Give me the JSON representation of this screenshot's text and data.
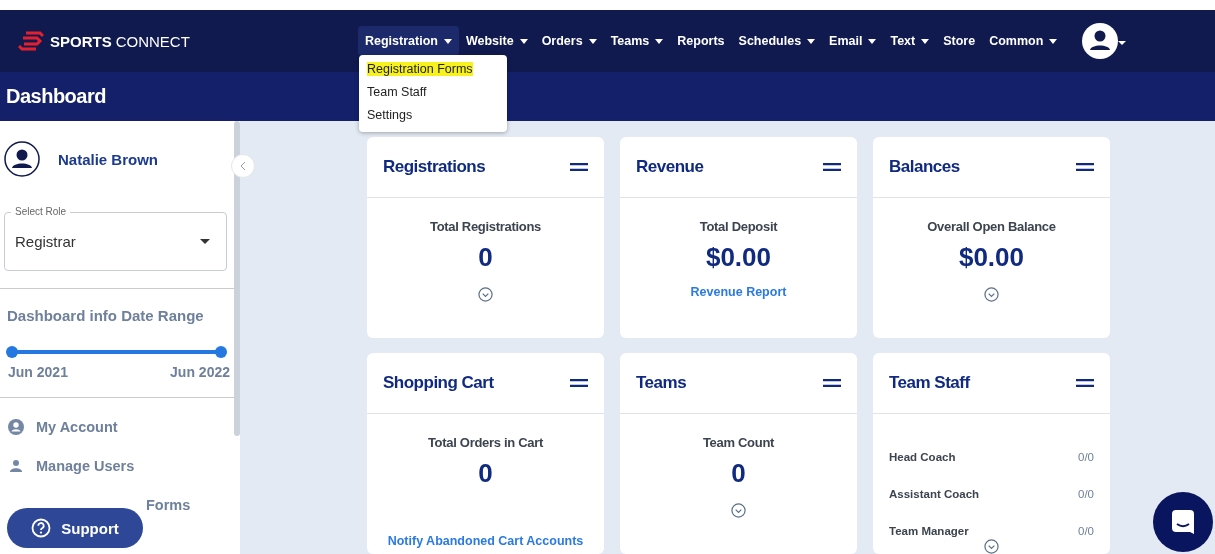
{
  "header": {
    "logo": {
      "bold": "SPORTS",
      "light": "CONNECT"
    },
    "menu": [
      {
        "label": "Registration",
        "caret": true,
        "selected": true
      },
      {
        "label": "Website",
        "caret": true,
        "selected": false
      },
      {
        "label": "Orders",
        "caret": true,
        "selected": false
      },
      {
        "label": "Teams",
        "caret": true,
        "selected": false
      },
      {
        "label": "Reports",
        "caret": false,
        "selected": false
      },
      {
        "label": "Schedules",
        "caret": true,
        "selected": false
      },
      {
        "label": "Email",
        "caret": true,
        "selected": false
      },
      {
        "label": "Text",
        "caret": true,
        "selected": false
      },
      {
        "label": "Store",
        "caret": false,
        "selected": false
      },
      {
        "label": "Common",
        "caret": true,
        "selected": false
      }
    ],
    "dropdown": [
      {
        "label": "Registration Forms",
        "highlighted": true
      },
      {
        "label": "Team Staff",
        "highlighted": false
      },
      {
        "label": "Settings",
        "highlighted": false
      }
    ]
  },
  "page_title": "Dashboard",
  "sidebar": {
    "user": "Natalie Brown",
    "role_field": {
      "label": "Select Role",
      "value": "Registrar"
    },
    "date_range": {
      "title": "Dashboard info Date Range",
      "thumbs": [
        {
          "level": 0
        },
        {
          "level": 1
        }
      ],
      "start": "Jun 2021",
      "end": "Jun 2022"
    },
    "items": [
      {
        "label": "My Account",
        "kind": "account"
      },
      {
        "label": "Manage Users",
        "kind": "user"
      },
      {
        "label": "Forms",
        "kind": "covered"
      }
    ],
    "support": "Support"
  },
  "cards": [
    {
      "title": "Registrations",
      "kind": "metric",
      "label": "Total Registrations",
      "value": "0",
      "expand": true
    },
    {
      "title": "Revenue",
      "kind": "metric",
      "label": "Total Deposit",
      "value": "$0.00",
      "link": "Revenue Report",
      "expand": false
    },
    {
      "title": "Balances",
      "kind": "metric",
      "label": "Overall Open Balance",
      "value": "$0.00",
      "expand": true
    },
    {
      "title": "Shopping Cart",
      "kind": "metric",
      "label": "Total Orders in Cart",
      "value": "0",
      "link": "Notify Abandoned Cart Accounts",
      "expand": false
    },
    {
      "title": "Teams",
      "kind": "metric",
      "label": "Team Count",
      "value": "0",
      "expand": true
    },
    {
      "title": "Team Staff",
      "kind": "staff",
      "rows": [
        {
          "role": "Head Coach",
          "count": "0/0"
        },
        {
          "role": "Assistant Coach",
          "count": "0/0"
        },
        {
          "role": "Team Manager",
          "count": "0/0"
        }
      ],
      "expand": true
    }
  ]
}
